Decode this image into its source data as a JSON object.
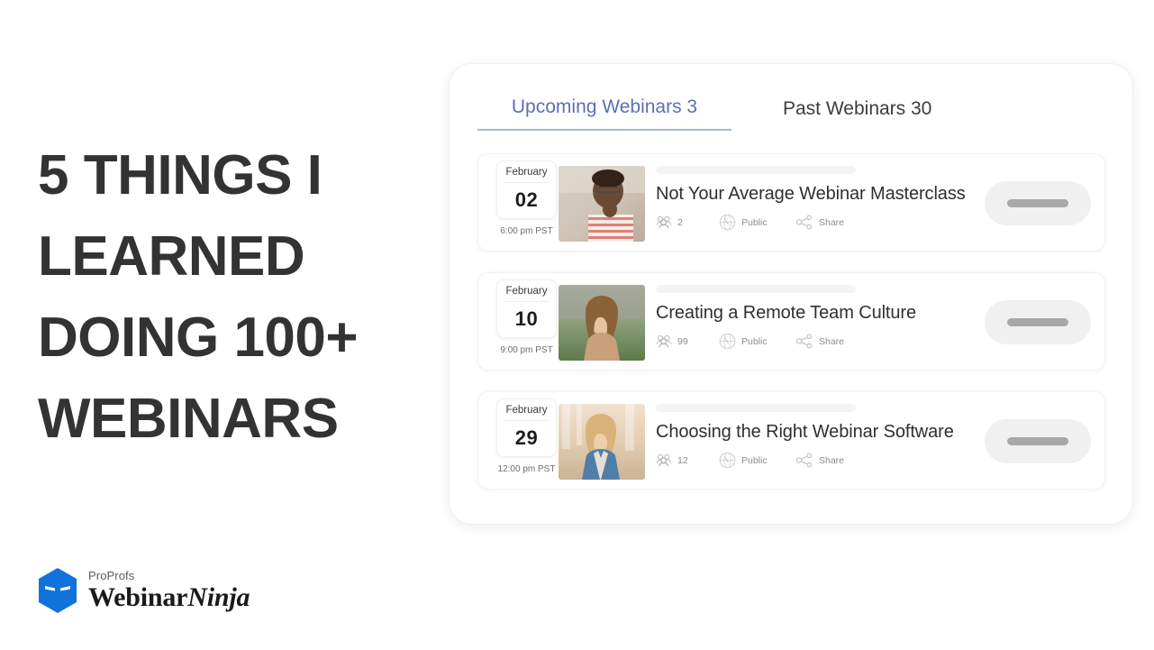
{
  "headline": {
    "lines": [
      "5 THINGS I",
      "LEARNED",
      "DOING 100+",
      "WEBINARS"
    ],
    "color": "#333333"
  },
  "logo": {
    "superscript": "ProProfs",
    "name_bold": "Webinar",
    "name_italic": "Ninja",
    "mark": "hexagon-ninja-icon",
    "mark_color": "#1073DC"
  },
  "panel": {
    "tabs": [
      {
        "label": "Upcoming Webinars 3",
        "active": true,
        "color": "#5a70b4"
      },
      {
        "label": "Past Webinars 30",
        "active": false,
        "color": "#3c3c3c"
      }
    ],
    "cards": [
      {
        "month": "February",
        "day": "02",
        "time": "6:00 pm PST",
        "title": "Not Your Average Webinar Masterclass",
        "attendees": "2",
        "visibility": "Public",
        "share": "Share",
        "thumbnail": "person-portrait-1",
        "action_placeholder": "loading-button"
      },
      {
        "month": "February",
        "day": "10",
        "time": "9:00 pm PST",
        "title": "Creating a Remote Team Culture",
        "attendees": "99",
        "visibility": "Public",
        "share": "Share",
        "thumbnail": "person-portrait-2",
        "action_placeholder": "loading-button"
      },
      {
        "month": "February",
        "day": "29",
        "time": "12:00 pm PST",
        "title": "Choosing the Right Webinar Software",
        "attendees": "12",
        "visibility": "Public",
        "share": "Share",
        "thumbnail": "person-portrait-3",
        "action_placeholder": "loading-button"
      }
    ]
  }
}
